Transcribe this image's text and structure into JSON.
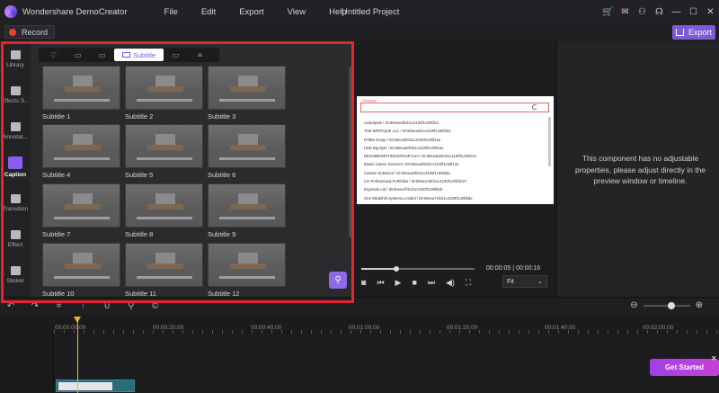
{
  "titlebar": {
    "app_name": "Wondershare DemoCreator",
    "menu": [
      "File",
      "Edit",
      "Export",
      "View",
      "Help"
    ],
    "project_title": "Untitled Project",
    "icons": [
      "cart-icon",
      "mail-icon",
      "user-icon",
      "support-icon",
      "minimize-icon",
      "maximize-icon",
      "close-icon"
    ]
  },
  "toolbar": {
    "record_label": "Record",
    "export_label": "Export"
  },
  "sidebar": {
    "items": [
      {
        "label": "Library",
        "icon": "library-icon"
      },
      {
        "label": "Effects S...",
        "icon": "effects-icon"
      },
      {
        "label": "Annotat...",
        "icon": "annotation-icon"
      },
      {
        "label": "Caption",
        "icon": "caption-icon",
        "active": true
      },
      {
        "label": "Transition",
        "icon": "transition-icon"
      },
      {
        "label": "Effect",
        "icon": "effect-wand-icon"
      },
      {
        "label": "Sticker",
        "icon": "sticker-icon"
      }
    ]
  },
  "caption_panel": {
    "tabs": [
      {
        "icon": "heart-icon",
        "symbol": "♡"
      },
      {
        "icon": "title-icon",
        "symbol": "▭"
      },
      {
        "icon": "lower-third-icon",
        "symbol": "▭"
      },
      {
        "label": "Subtitle",
        "icon": "subtitle-icon",
        "active": true
      },
      {
        "icon": "caption-box-icon",
        "symbol": "▭"
      },
      {
        "icon": "list-icon",
        "symbol": "≡"
      }
    ],
    "thumbnails": [
      "Subtitle 1",
      "Subtitle 2",
      "Subtitle 3",
      "Subtitle 4",
      "Subtitle 5",
      "Subtitle 6",
      "Subtitle 7",
      "Subtitle 8",
      "Subtitle 9",
      "Subtitle 10",
      "Subtitle 11",
      "Subtitle 12"
    ]
  },
  "preview": {
    "frame_title": "Company",
    "rows": [
      "codeSpark / ID:60eeaef0cb1c4100f1c05f1b4",
      "THE WRITIQUE LLC / ID:60eeaeb1c4100f1c05f1b2",
      "RTBM Group / ID:60eeaf0cb1c4100f1c05f1ae",
      "Little Big Byte / ID:60eeaef0cb1c4100f1c05f1ae",
      "RESUMEWRITINGGROUP.Com / ID:60eea0e0cb1c4100f1c05f144",
      "Bowie Career Services / ID:60eea4f0cb1c4100f1c05f142",
      "Custom Solutions / ID:60eea4f0cb1c4100f1c05f3da",
      "CG Professional Portfolios / ID:60eea7afcb1c4100f1c05f1b27",
      "ErgoSolo Ltd / ID:60eea7f4cb1c4100f1c05f6d3",
      "One Mindshift Systems Limited / ID:60eea71fcb1c4100f1c05f6d2"
    ],
    "time": "00:00:05 | 00:00:16",
    "progress": 0.31,
    "zoom_label": "Fit"
  },
  "properties": {
    "message": "This component has no adjustable properties, please adjust directly in the preview window or timeline."
  },
  "timeline": {
    "ruler": [
      "00:00:00:00",
      "00:00:20:00",
      "00:00:40:00",
      "00:01:00:00",
      "00:01:20:00",
      "00:01:40:00",
      "00:02:00:00"
    ],
    "get_started_label": "Get Started",
    "zoom_level": 0.6
  }
}
